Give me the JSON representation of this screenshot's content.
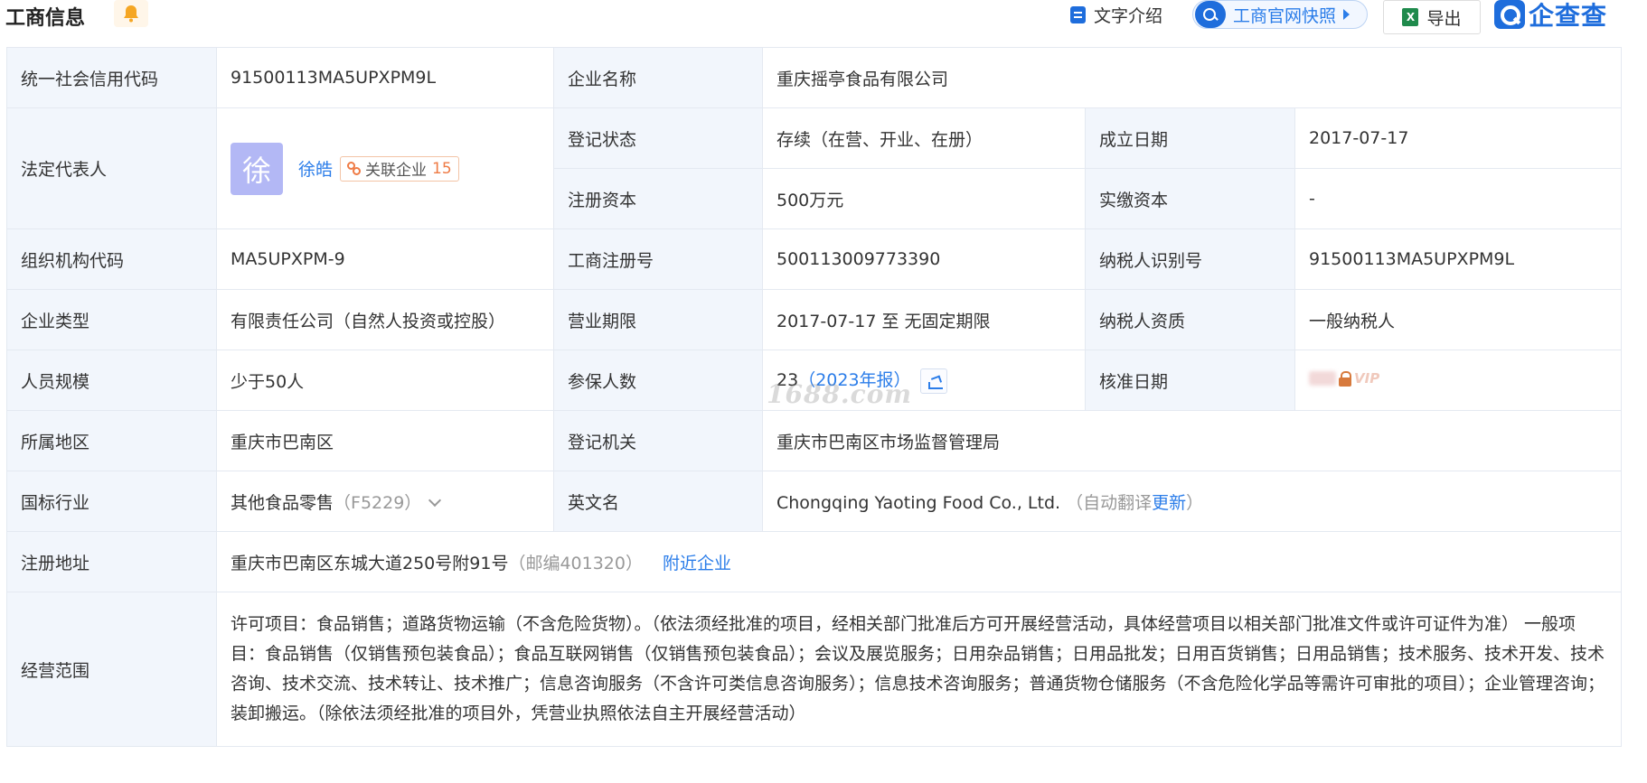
{
  "header": {
    "title": "工商信息",
    "intro_label": "文字介绍",
    "snapshot_label": "工商官网快照",
    "export_label": "导出",
    "export_icon_text": "X",
    "brand": "企查查"
  },
  "colors": {
    "accent": "#2b7de9",
    "label_bg": "#f2f6fc",
    "orange": "#ef7b45"
  },
  "rows": {
    "credit_code": {
      "label": "统一社会信用代码",
      "value": "91500113MA5UPXPM9L"
    },
    "company_name": {
      "label": "企业名称",
      "value": "重庆摇亭食品有限公司"
    },
    "legal_rep": {
      "label": "法定代表人",
      "avatar_char": "徐",
      "name": "徐皓",
      "related_label": "关联企业",
      "related_count": "15"
    },
    "reg_status": {
      "label": "登记状态",
      "value": "存续（在营、开业、在册）"
    },
    "founded": {
      "label": "成立日期",
      "value": "2017-07-17"
    },
    "reg_capital": {
      "label": "注册资本",
      "value": "500万元"
    },
    "paid_capital": {
      "label": "实缴资本",
      "value": "-"
    },
    "org_code": {
      "label": "组织机构代码",
      "value": "MA5UPXPM-9"
    },
    "biz_reg_no": {
      "label": "工商注册号",
      "value": "500113009773390"
    },
    "taxpayer_id": {
      "label": "纳税人识别号",
      "value": "91500113MA5UPXPM9L"
    },
    "company_type": {
      "label": "企业类型",
      "value": "有限责任公司（自然人投资或控股）"
    },
    "biz_term": {
      "label": "营业期限",
      "value": "2017-07-17 至 无固定期限"
    },
    "taxpayer_qual": {
      "label": "纳税人资质",
      "value": "一般纳税人"
    },
    "staff_size": {
      "label": "人员规模",
      "value": "少于50人"
    },
    "insured": {
      "label": "参保人数",
      "value": "23",
      "report": "（2023年报）"
    },
    "approval_date": {
      "label": "核准日期",
      "vip": "VIP"
    },
    "region": {
      "label": "所属地区",
      "value": "重庆市巴南区"
    },
    "reg_authority": {
      "label": "登记机关",
      "value": "重庆市巴南区市场监督管理局"
    },
    "industry": {
      "label": "国标行业",
      "value": "其他食品零售",
      "code": "（F5229）"
    },
    "english_name": {
      "label": "英文名",
      "value": "Chongqing Yaoting Food Co., Ltd.",
      "note_open": "（自动翻译",
      "update_link": "更新",
      "note_close": "）"
    },
    "reg_address": {
      "label": "注册地址",
      "value": "重庆市巴南区东城大道250号附91号",
      "postcode": "（邮编401320）",
      "nearby_link": "附近企业"
    },
    "biz_scope": {
      "label": "经营范围",
      "value": "许可项目：食品销售；道路货物运输（不含危险货物）。（依法须经批准的项目，经相关部门批准后方可开展经营活动，具体经营项目以相关部门批准文件或许可证件为准） 一般项目：食品销售（仅销售预包装食品）；食品互联网销售（仅销售预包装食品）；会议及展览服务；日用杂品销售；日用品批发；日用百货销售；日用品销售；技术服务、技术开发、技术咨询、技术交流、技术转让、技术推广；信息咨询服务（不含许可类信息咨询服务）；信息技术咨询服务；普通货物仓储服务（不含危险化学品等需许可审批的项目）；企业管理咨询；装卸搬运。（除依法须经批准的项目外，凭营业执照依法自主开展经营活动）"
    }
  },
  "watermark": "1688.com"
}
